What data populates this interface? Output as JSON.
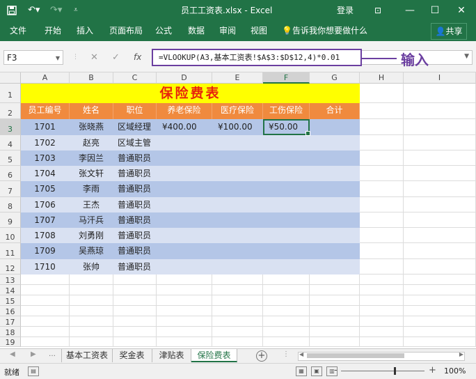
{
  "title_bar": {
    "save_icon": "save-icon",
    "undo_icon": "undo-icon",
    "redo_icon": "redo-icon",
    "file_title": "员工工资表.xlsx  -  Excel",
    "login": "登录",
    "restore_icon": "ribbon-display-icon",
    "minimize_icon": "minimize-icon",
    "maximize_icon": "maximize-icon",
    "close_icon": "close-icon"
  },
  "ribbon": {
    "tabs": [
      "文件",
      "开始",
      "插入",
      "页面布局",
      "公式",
      "数据",
      "审阅",
      "视图"
    ],
    "tell_me": "告诉我你想要做什么",
    "share": "共享"
  },
  "formula_bar": {
    "name_box": "F3",
    "cancel_symbol": "✕",
    "enter_symbol": "✓",
    "fx_symbol": "fx",
    "formula": "=VLOOKUP(A3,基本工资表!$A$3:$D$12,4)*0.01"
  },
  "callout": {
    "text": "输入",
    "color": "#6b3fa0"
  },
  "grid": {
    "columns": [
      "A",
      "B",
      "C",
      "D",
      "E",
      "F",
      "G",
      "H",
      "I"
    ],
    "rows": [
      "1",
      "2",
      "3",
      "4",
      "5",
      "6",
      "7",
      "8",
      "9",
      "10",
      "11",
      "12",
      "13",
      "14",
      "15",
      "16",
      "17",
      "18",
      "19"
    ],
    "sheet_title": "保险费表",
    "headers": [
      "员工编号",
      "姓名",
      "职位",
      "养老保险",
      "医疗保险",
      "工伤保险",
      "合计"
    ],
    "records": [
      {
        "id": "1701",
        "name": "张晓燕",
        "position": "区域经理",
        "pension": "¥400.00",
        "medical": "¥100.00",
        "injury": "¥50.00",
        "total": ""
      },
      {
        "id": "1702",
        "name": "赵亮",
        "position": "区域主管",
        "pension": "",
        "medical": "",
        "injury": "",
        "total": ""
      },
      {
        "id": "1703",
        "name": "李因兰",
        "position": "普通职员",
        "pension": "",
        "medical": "",
        "injury": "",
        "total": ""
      },
      {
        "id": "1704",
        "name": "张文轩",
        "position": "普通职员",
        "pension": "",
        "medical": "",
        "injury": "",
        "total": ""
      },
      {
        "id": "1705",
        "name": "李雨",
        "position": "普通职员",
        "pension": "",
        "medical": "",
        "injury": "",
        "total": ""
      },
      {
        "id": "1706",
        "name": "王杰",
        "position": "普通职员",
        "pension": "",
        "medical": "",
        "injury": "",
        "total": ""
      },
      {
        "id": "1707",
        "name": "马汗兵",
        "position": "普通职员",
        "pension": "",
        "medical": "",
        "injury": "",
        "total": ""
      },
      {
        "id": "1708",
        "name": "刘勇刚",
        "position": "普通职员",
        "pension": "",
        "medical": "",
        "injury": "",
        "total": ""
      },
      {
        "id": "1709",
        "name": "吴燕琼",
        "position": "普通职员",
        "pension": "",
        "medical": "",
        "injury": "",
        "total": ""
      },
      {
        "id": "1710",
        "name": "张帅",
        "position": "普通职员",
        "pension": "",
        "medical": "",
        "injury": "",
        "total": ""
      }
    ],
    "active_cell": "F3",
    "colors": {
      "title_bg": "#ffff00",
      "title_text": "#e8240c",
      "header_bg": "#f08a3e",
      "band_dark": "#b4c6e7",
      "band_light": "#d9e1f2",
      "excel_green": "#217346"
    }
  },
  "sheet_tabs": {
    "tabs": [
      "基本工资表",
      "奖金表",
      "津贴表",
      "保险费表"
    ],
    "active": "保险费表",
    "add_icon": "add-sheet-icon"
  },
  "status_bar": {
    "ready": "就绪",
    "zoom": "100%",
    "minus": "-",
    "plus": "+"
  }
}
